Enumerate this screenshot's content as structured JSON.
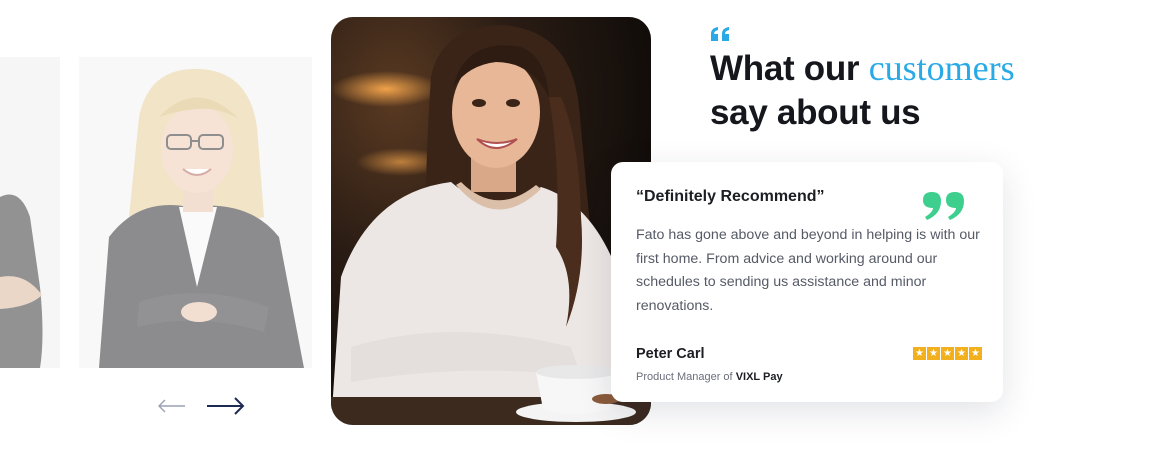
{
  "heading": {
    "line1_prefix": "What our",
    "line1_accent": "customers",
    "line2": "say about us"
  },
  "testimonial": {
    "title": "“Definitely Recommend”",
    "body": "Fato has gone above and beyond in helping is with our first home. From advice and working around our schedules to sending us assistance and minor renovations.",
    "author": "Peter Carl",
    "role_prefix": "Product Manager of",
    "company": "VIXL Pay",
    "rating": 5,
    "star_glyph": "★"
  },
  "navigation": {
    "prev_icon": "arrow-left-icon",
    "next_icon": "arrow-right-icon"
  },
  "colors": {
    "accent_blue": "#29a9e6",
    "quote_green": "#3ecf8e",
    "star_gold": "#f2b01e",
    "heading_dark": "#15171c",
    "body_gray": "#555a66"
  }
}
